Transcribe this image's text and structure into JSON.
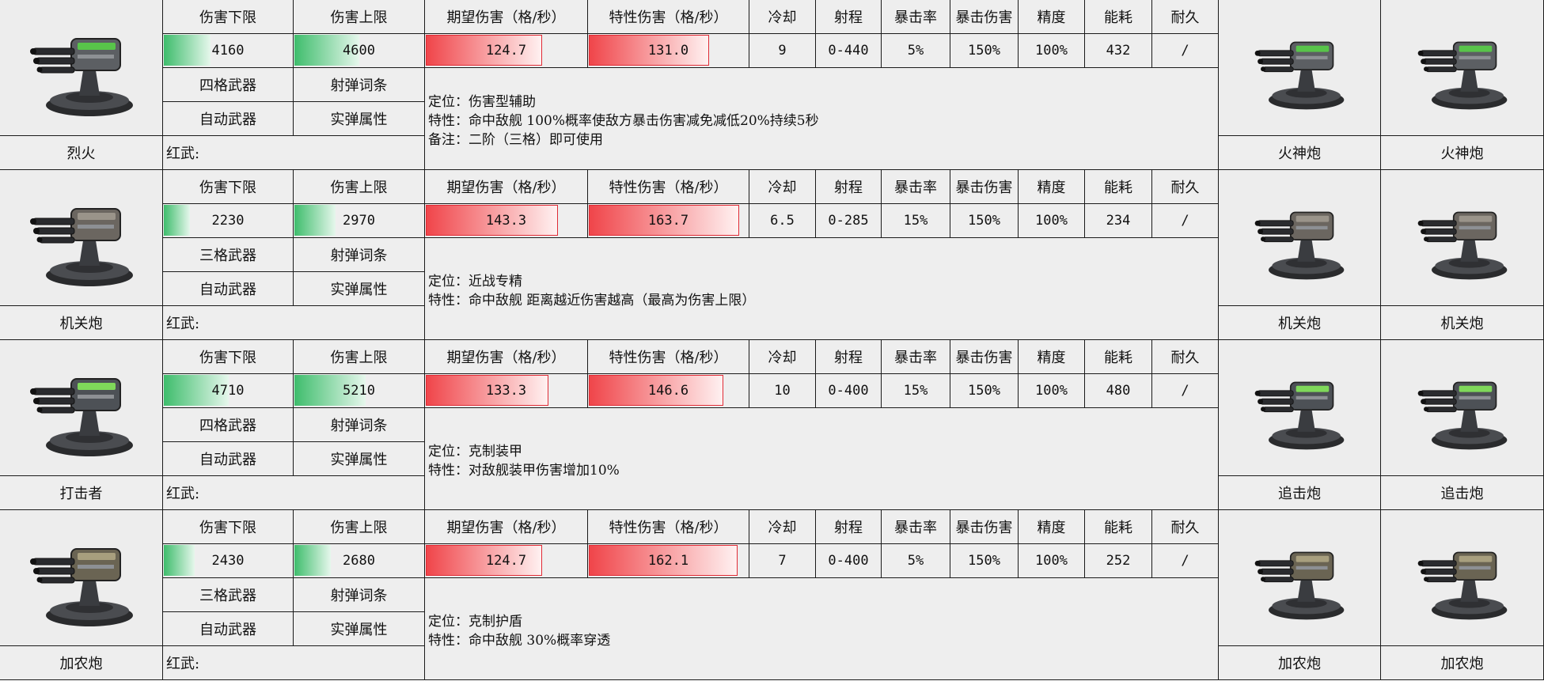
{
  "headers": {
    "dmg_min": "伤害下限",
    "dmg_max": "伤害上限",
    "expected_dmg": "期望伤害（格/秒）",
    "special_dmg": "特性伤害（格/秒）",
    "cooldown": "冷却",
    "range": "射程",
    "crit_rate": "暴击率",
    "crit_dmg": "暴击伤害",
    "accuracy": "精度",
    "energy": "能耗",
    "durability": "耐久"
  },
  "red_weapon_label": "红武:",
  "weapons": [
    {
      "name": "烈火",
      "dmg_min": "4160",
      "dmg_min_level": 0.36,
      "dmg_max": "4600",
      "dmg_max_level": 0.5,
      "expected_dmg": "124.7",
      "expected_level": 0.72,
      "special_dmg": "131.0",
      "special_level": 0.75,
      "cooldown": "9",
      "range": "0-440",
      "crit_rate": "5%",
      "crit_dmg": "150%",
      "accuracy": "100%",
      "energy": "432",
      "durability": "/",
      "slot_type": "四格武器",
      "tag": "射弹词条",
      "mode": "自动武器",
      "attribute": "实弹属性",
      "lines": [
        "定位：伤害型辅助",
        "特性：命中敌舰 100%概率使敌方暴击伤害减免减低20%持续5秒",
        "备注：二阶（三格）即可使用"
      ],
      "upgrade_1": "火神炮",
      "upgrade_2": "火神炮",
      "color_body": "#5c5f63",
      "color_accent": "#58c44a"
    },
    {
      "name": "机关炮",
      "dmg_min": "2230",
      "dmg_min_level": 0.2,
      "dmg_max": "2970",
      "dmg_max_level": 0.32,
      "expected_dmg": "143.3",
      "expected_level": 0.82,
      "special_dmg": "163.7",
      "special_level": 0.94,
      "cooldown": "6.5",
      "range": "0-285",
      "crit_rate": "15%",
      "crit_dmg": "150%",
      "accuracy": "100%",
      "energy": "234",
      "durability": "/",
      "slot_type": "三格武器",
      "tag": "射弹词条",
      "mode": "自动武器",
      "attribute": "实弹属性",
      "lines": [
        "定位：近战专精",
        "特性：命中敌舰 距离越近伤害越高（最高为伤害上限）"
      ],
      "upgrade_1": "机关炮",
      "upgrade_2": "机关炮",
      "color_body": "#6b6660",
      "color_accent": "#9a948a"
    },
    {
      "name": "打击者",
      "dmg_min": "4710",
      "dmg_min_level": 0.5,
      "dmg_max": "5210",
      "dmg_max_level": 0.55,
      "expected_dmg": "133.3",
      "expected_level": 0.76,
      "special_dmg": "146.6",
      "special_level": 0.84,
      "cooldown": "10",
      "range": "0-400",
      "crit_rate": "15%",
      "crit_dmg": "150%",
      "accuracy": "100%",
      "energy": "480",
      "durability": "/",
      "slot_type": "四格武器",
      "tag": "射弹词条",
      "mode": "自动武器",
      "attribute": "实弹属性",
      "lines": [
        "定位：克制装甲",
        "特性：对敌舰装甲伤害增加10%"
      ],
      "upgrade_1": "追击炮",
      "upgrade_2": "追击炮",
      "color_body": "#4d5156",
      "color_accent": "#7fd85a"
    },
    {
      "name": "加农炮",
      "dmg_min": "2430",
      "dmg_min_level": 0.24,
      "dmg_max": "2680",
      "dmg_max_level": 0.28,
      "expected_dmg": "124.7",
      "expected_level": 0.72,
      "special_dmg": "162.1",
      "special_level": 0.93,
      "cooldown": "7",
      "range": "0-400",
      "crit_rate": "5%",
      "crit_dmg": "150%",
      "accuracy": "100%",
      "energy": "252",
      "durability": "/",
      "slot_type": "三格武器",
      "tag": "射弹词条",
      "mode": "自动武器",
      "attribute": "实弹属性",
      "lines": [
        "定位：克制护盾",
        "特性：命中敌舰 30%概率穿透"
      ],
      "upgrade_1": "加农炮",
      "upgrade_2": "加农炮",
      "color_body": "#6a6453",
      "color_accent": "#a89f7e"
    }
  ]
}
